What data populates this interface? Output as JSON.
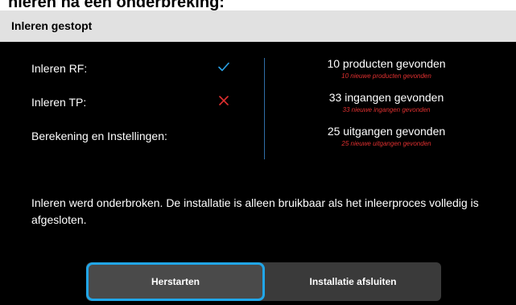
{
  "page": {
    "heading": "nleren na een onderbreking:"
  },
  "dialog": {
    "title": "Inleren gestopt",
    "status_items": [
      {
        "label": "Inleren RF:",
        "icon": "check-icon",
        "icon_color": "#2aa3e8"
      },
      {
        "label": "Inleren TP:",
        "icon": "cross-icon",
        "icon_color": "#e03030"
      },
      {
        "label": "Berekening en Instellingen:"
      }
    ],
    "results": [
      {
        "count": "10 producten gevonden",
        "new": "10 nieuwe producten gevonden"
      },
      {
        "count": "33 ingangen gevonden",
        "new": "33 nieuwe ingangen gevonden"
      },
      {
        "count": "25 uitgangen gevonden",
        "new": "25 nieuwe uitgangen gevonden"
      }
    ],
    "message": "Inleren werd onderbroken. De installatie is alleen bruikbaar als het inleerproces volledig is afgesloten.",
    "buttons": {
      "restart": "Herstarten",
      "exit": "Installatie afsluiten"
    }
  },
  "colors": {
    "dialog_background": "#000000",
    "header_background": "#e1e1e1",
    "accent": "#21a6e8",
    "error": "#e03030",
    "button_background": "#3a3a3a"
  }
}
